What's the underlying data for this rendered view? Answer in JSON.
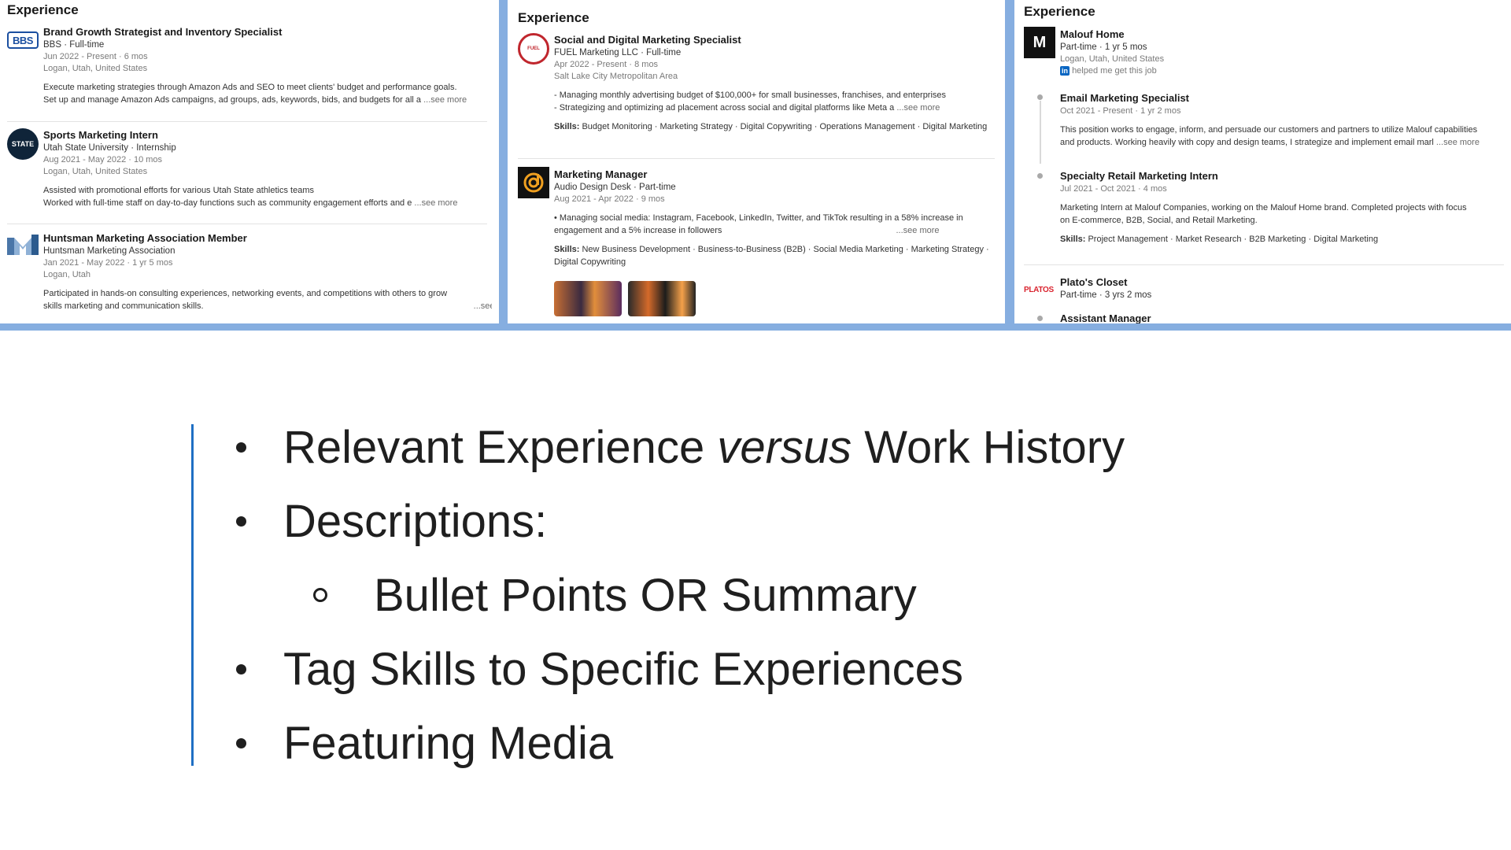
{
  "panels": [
    {
      "heading": "Experience",
      "entries": [
        {
          "logo": "BBS",
          "title": "Brand Growth Strategist and Inventory Specialist",
          "org": "BBS · Full-time",
          "dates": "Jun 2022 - Present · 6 mos",
          "location": "Logan, Utah, United States",
          "desc": [
            "Execute marketing strategies through Amazon Ads and SEO to meet clients' budget and performance goals.",
            "Set up and manage Amazon Ads campaigns, ad groups, ads, keywords, bids, and budgets for all a"
          ],
          "see_more": "...see more"
        },
        {
          "logo": "STATE",
          "title": "Sports Marketing Intern",
          "org": "Utah State University · Internship",
          "dates": "Aug 2021 - May 2022 · 10 mos",
          "location": "Logan, Utah, United States",
          "desc": [
            "Assisted with promotional efforts for various Utah State athletics teams",
            "Worked with full-time staff on day-to-day functions such as community engagement efforts and e"
          ],
          "see_more": "...see more"
        },
        {
          "logo": "",
          "title": "Huntsman Marketing Association Member",
          "org": "Huntsman Marketing Association",
          "dates": "Jan 2021 - May 2022 · 1 yr 5 mos",
          "location": "Logan, Utah",
          "desc": [
            "Participated in hands-on consulting experiences, networking events, and competitions with others to grow",
            "skills marketing and communication skills."
          ],
          "see_more": "...see more"
        }
      ]
    },
    {
      "heading": "Experience",
      "entries": [
        {
          "logo": "FUEL",
          "title": "Social and Digital Marketing Specialist",
          "org": "FUEL Marketing LLC · Full-time",
          "dates": "Apr 2022 - Present · 8 mos",
          "location": "Salt Lake City Metropolitan Area",
          "desc": [
            "- Managing monthly advertising budget of $100,000+ for small businesses, franchises, and enterprises",
            "- Strategizing and optimizing ad placement across social and digital platforms like Meta a"
          ],
          "see_more": "...see more",
          "skills_label": "Skills:",
          "skills": "Budget Monitoring · Marketing Strategy · Digital Copywriting · Operations Management · Digital Marketing"
        },
        {
          "logo": "",
          "title": "Marketing Manager",
          "org": "Audio Design Desk · Part-time",
          "dates": "Aug 2021 - Apr 2022 · 9 mos",
          "desc": [
            "• Managing social media: Instagram, Facebook, LinkedIn, Twitter, and TikTok resulting in a 58% increase in",
            "engagement and a 5% increase in followers"
          ],
          "see_more": "...see more",
          "skills_label": "Skills:",
          "skills": "New Business Development · Business-to-Business (B2B) · Social Media Marketing · Marketing Strategy · Digital Copywriting"
        }
      ]
    },
    {
      "heading": "Experience",
      "company": {
        "logo": "M",
        "name": "Malouf Home",
        "type": "Part-time · 1 yr 5 mos",
        "location": "Logan, Utah, United States",
        "linkedin_badge": "in",
        "note": "helped me get this job"
      },
      "roles": [
        {
          "title": "Email Marketing Specialist",
          "dates": "Oct 2021 - Present · 1 yr 2 mos",
          "desc": [
            "This position works to engage, inform, and persuade our customers and partners to utilize Malouf capabilities",
            "and products. Working heavily with copy and design teams, I strategize and implement email marl"
          ],
          "see_more": "...see more"
        },
        {
          "title": "Specialty Retail Marketing Intern",
          "dates": "Jul 2021 - Oct 2021 · 4 mos",
          "desc": [
            "Marketing Intern at Malouf Companies, working on the Malouf Home brand. Completed projects with focus",
            "on E-commerce, B2B, Social, and Retail Marketing."
          ],
          "skills_label": "Skills:",
          "skills": "Project Management · Market Research · B2B Marketing · Digital Marketing"
        }
      ],
      "company2": {
        "logo": "PLATOS",
        "name": "Plato's Closet",
        "type": "Part-time · 3 yrs 2 mos",
        "role": "Assistant Manager"
      }
    }
  ],
  "slide": {
    "bullets": [
      {
        "level": 1,
        "pre": "Relevant Experience ",
        "em": "versus",
        "post": " Work History"
      },
      {
        "level": 1,
        "text": "Descriptions:"
      },
      {
        "level": 2,
        "text": "Bullet Points OR Summary"
      },
      {
        "level": 1,
        "text": "Tag Skills to Specific Experiences"
      },
      {
        "level": 1,
        "text": "Featuring Media"
      }
    ]
  },
  "colors": {
    "accent_bar": "#1f6fc4",
    "strip_border": "#86aee0"
  },
  "icons": [
    "bbs-logo-icon",
    "utah-state-logo-icon",
    "huntsman-logo-icon",
    "fuel-logo-icon",
    "audio-design-desk-logo-icon",
    "malouf-logo-icon",
    "linkedin-icon",
    "platos-closet-logo-icon"
  ]
}
